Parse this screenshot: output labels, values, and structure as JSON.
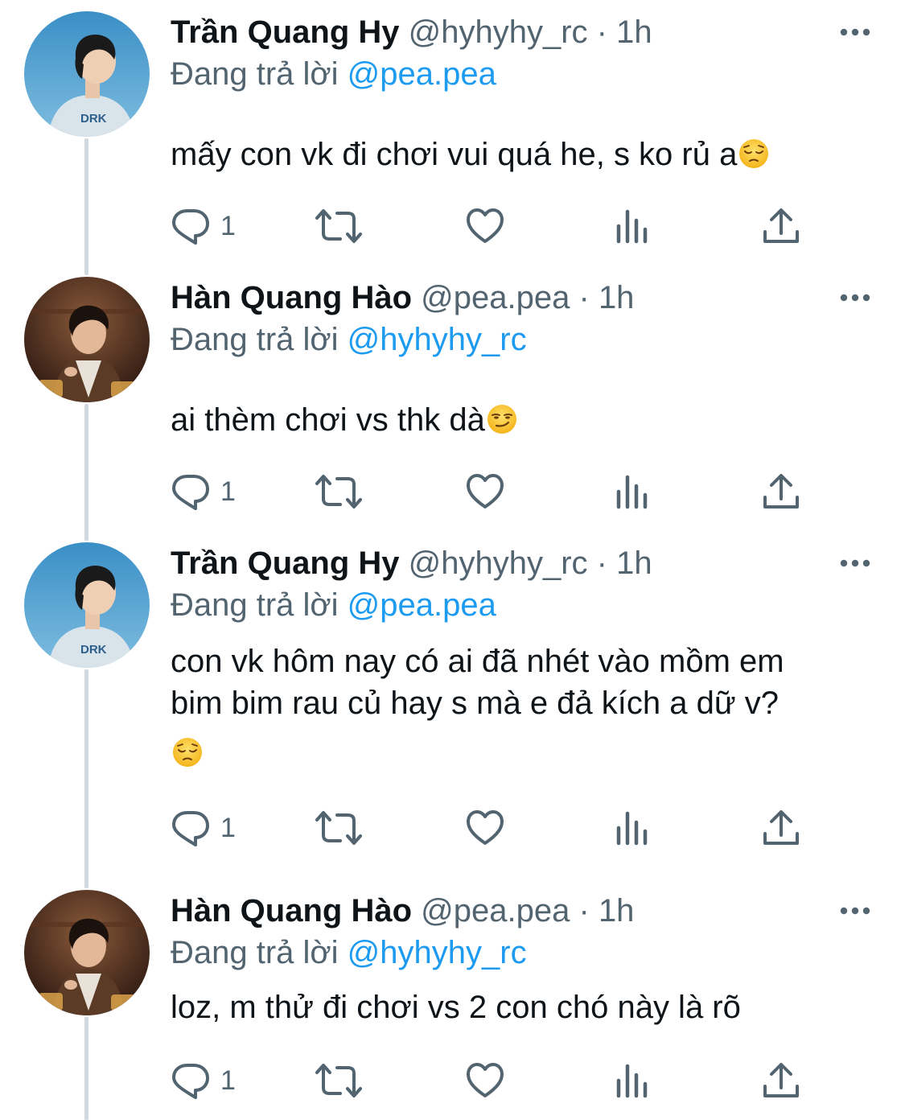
{
  "tweets": [
    {
      "display_name": "Trần Quang Hy",
      "handle": "@hyhyhy_rc",
      "separator": "·",
      "time": "1h",
      "replying_prefix": "Đang trả lời",
      "replying_to": "@pea.pea",
      "lines": [
        "mấy con vk đi chơi vui quá he, s ko rủ a"
      ],
      "emoji": "pensive-face",
      "emoji_on_own_line": false,
      "reply_count": "1",
      "avatar": "avatar-hy"
    },
    {
      "display_name": "Hàn Quang Hào",
      "handle": "@pea.pea",
      "separator": "·",
      "time": "1h",
      "replying_prefix": "Đang trả lời",
      "replying_to": "@hyhyhy_rc",
      "lines": [
        "ai thèm chơi vs thk dà"
      ],
      "emoji": "smirking-face",
      "emoji_on_own_line": false,
      "reply_count": "1",
      "avatar": "avatar-hao"
    },
    {
      "display_name": "Trần Quang Hy",
      "handle": "@hyhyhy_rc",
      "separator": "·",
      "time": "1h",
      "replying_prefix": "Đang trả lời",
      "replying_to": "@pea.pea",
      "lines": [
        "con vk hôm nay có ai đã nhét vào mồm em",
        "bim bim rau củ hay s mà e đả kích a dữ v?"
      ],
      "emoji": "pensive-face",
      "emoji_on_own_line": true,
      "reply_count": "1",
      "avatar": "avatar-hy"
    },
    {
      "display_name": "Hàn Quang Hào",
      "handle": "@pea.pea",
      "separator": "·",
      "time": "1h",
      "replying_prefix": "Đang trả lời",
      "replying_to": "@hyhyhy_rc",
      "lines": [
        "loz, m thử đi chơi vs 2 con chó này là rõ"
      ],
      "emoji": "",
      "emoji_on_own_line": false,
      "reply_count": "1",
      "avatar": "avatar-hao"
    }
  ],
  "icons": {
    "reply": "reply-icon",
    "retweet": "retweet-icon",
    "like": "like-icon",
    "views": "views-icon",
    "share": "share-icon",
    "more": "more-icon"
  },
  "colors": {
    "text": "#0f1419",
    "secondary": "#536471",
    "link": "#1d9bf0",
    "thread_line": "#cfd9de"
  }
}
